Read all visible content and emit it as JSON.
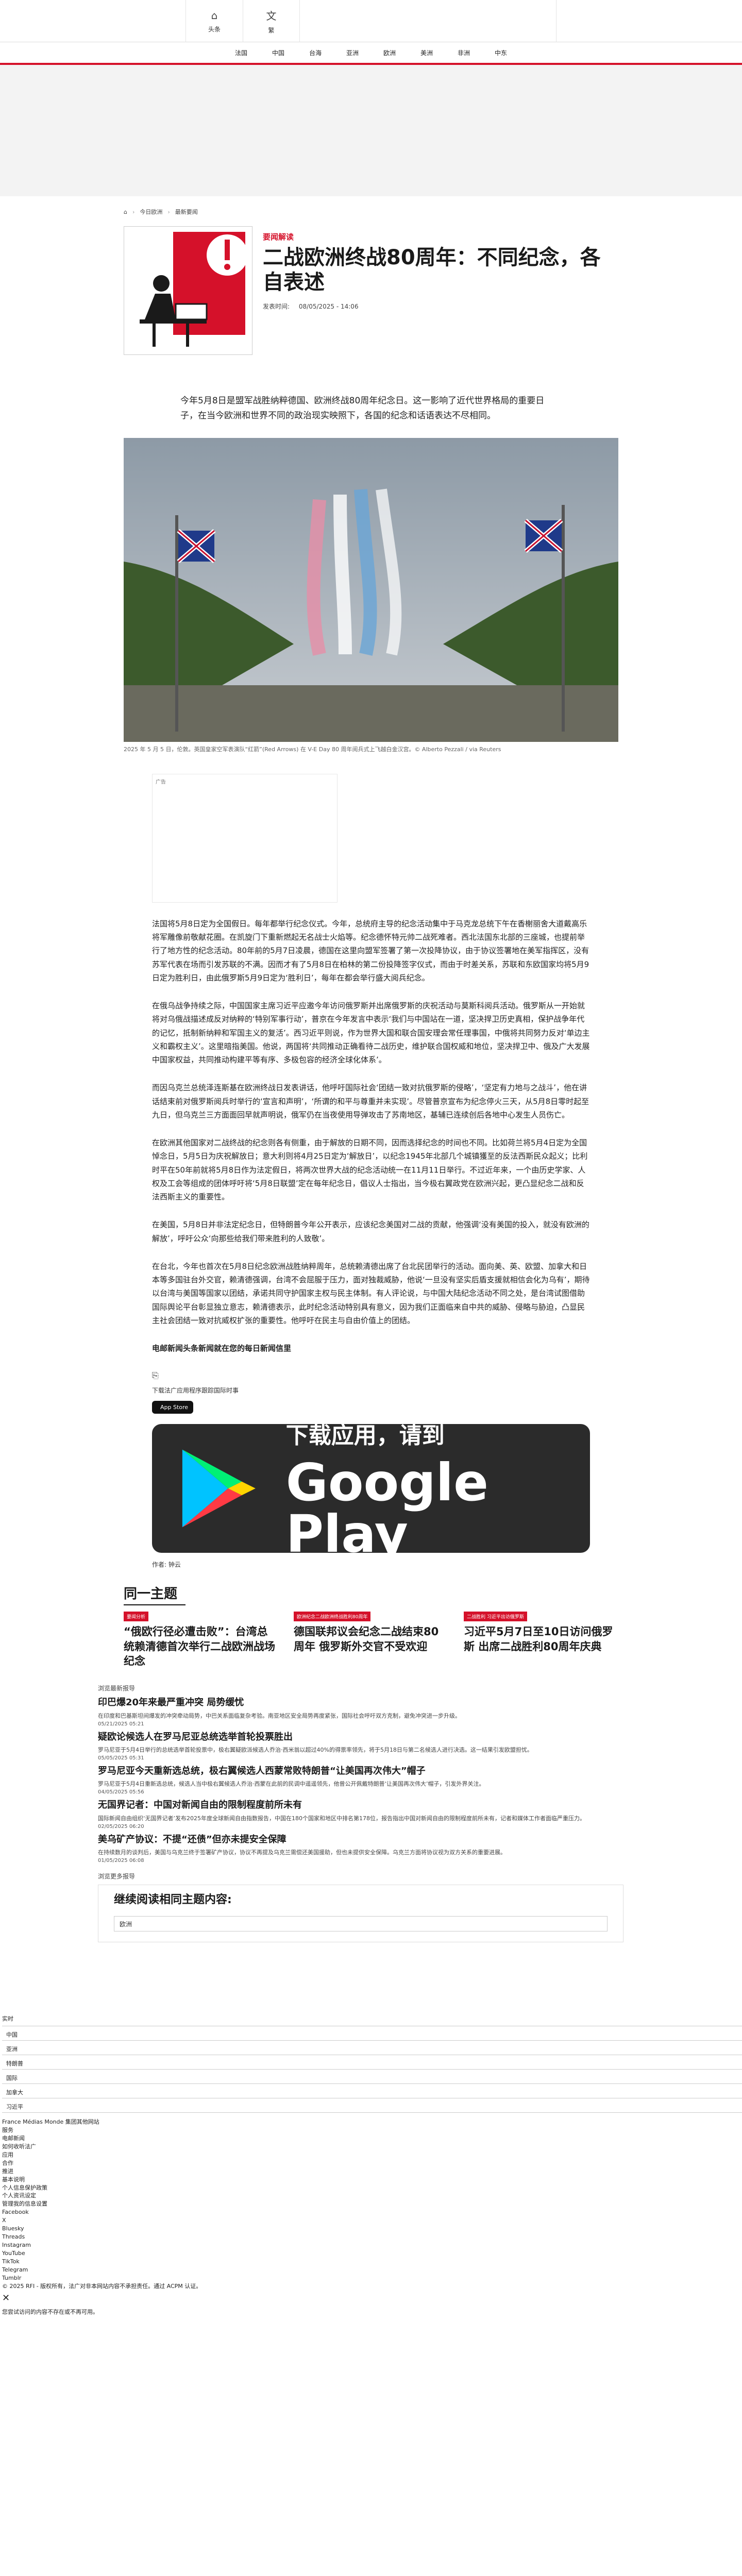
{
  "header": {
    "home_label": "头条",
    "translate_label": "繁"
  },
  "nav": [
    "法国",
    "中国",
    "台海",
    "亚洲",
    "欧洲",
    "美洲",
    "非洲",
    "中东"
  ],
  "breadcrumb": [
    "今日欧洲",
    "最新要闻"
  ],
  "article": {
    "kicker": "要闻解读",
    "title": "二战欧洲终战80周年：不同纪念，各自表述",
    "pub_label": "发表时间:",
    "pub_date": "08/05/2025 - 14:06",
    "lead": "今年5月8日是盟军战胜纳粹德国、欧洲终战80周年纪念日。这一影响了近代世界格局的重要日子，在当今欧洲和世界不同的政治现实映照下，各国的纪念和话语表达不尽相同。",
    "photo_caption": "2025 年 5 月 5 日，伦敦。英国皇家空军表演队“红箭”(Red Arrows) 在 V-E Day 80 周年阅兵式上飞越白金汉宫。© Alberto Pezzali / via Reuters",
    "ad_label": "广告",
    "paragraphs": [
      "法国将5月8日定为全国假日。每年都举行纪念仪式。今年，总统府主导的纪念活动集中于马克龙总统下午在香榭丽舍大道戴高乐将军雕像前敬献花圈。在凯旋门下重新燃起无名战士火焰等。纪念德怀特元帅二战死难者。西北法国东北部的三座城，也提前举行了地方性的纪念活动。80年前的5月7日凌晨，德国在这里向盟军签署了第一次投降协议，由于协议签署地在美军指挥区，没有苏军代表在场而引发苏联的不满。因而才有了5月8日在柏林的第二份投降签字仪式，而由于时差关系，苏联和东欧国家均将5月9日定为胜利日，由此俄罗斯5月9日定为‘胜利日’，每年在都会举行盛大阅兵纪念。",
      "在俄乌战争持续之际，中国国家主席习近平应邀今年访问俄罗斯并出席俄罗斯的庆祝活动与莫斯科阅兵活动。俄罗斯从一开始就将对乌俄战描述成反对纳粹的‘特别军事行动’，普京在今年发言中表示‘我们与中国站在一道，坚决捍卫历史真相，保护战争年代的记忆，抵制新纳粹和军国主义的复活’。西习近平则说，作为世界大国和联合国安理会常任理事国，中俄将共同努力反对‘单边主义和霸权主义’。这里暗指美国。他说，两国将‘共同推动正确看待二战历史，维护联合国权威和地位，坚决捍卫中、俄及广大发展中国家权益，共同推动构建平等有序、多极包容的经济全球化体系’。",
      "而因乌克兰总统泽连斯基在欧洲终战日发表讲话，他呼吁国际社会‘团结一致对抗俄罗斯的侵略’，‘坚定有力地与之战斗’，他在讲话结束前对俄罗斯阅兵时举行的‘宣言和声明’，‘所谓的和平与尊重并未实现’。尽管普京宣布为纪念停火三天，从5月8日零时起至九日，但乌克兰三方面面回早就声明说，俄军仍在当夜使用导弹攻击了苏南地区，基辅已连续创后各地中心发生人员伤亡。",
      "在欧洲其他国家对二战终战的纪念则各有侧重，由于解放的日期不同，因而选择纪念的时间也不同。比如荷兰将5月4日定为全国悼念日，5月5日为庆祝解放日；意大利则将4月25日定为‘解放日’，以纪念1945年北部几个城镇獲至的反法西斯民众起义；比利时平在50年前就将5月8日作为法定假日，将两次世界大战的纪念活动统一在11月11日举行。不过近年来，一个由历史学家、人权及工会等组成的团体呼吁将‘5月8日联盟’定在每年纪念日，倡议人士指出，当今极右翼政党在欧洲兴起，更凸显纪念二战和反法西斯主义的重要性。",
      "在美国，5月8日并非法定纪念日，但特朗普今年公开表示，应该纪念美国对二战的贡献，他强调‘没有美国的投入，就没有欧洲的解放’，呼吁公众‘向那些给我们带来胜利的人致敬’。",
      "在台北，今年也首次在5月8日纪念欧洲战胜纳粹周年，总统赖清德出席了台北民团举行的活动。面向美、英、欧盟、加拿大和日本等多国驻台外交官，赖清德强调，台湾不会屈服于压力，面对独裁威胁，他说‘一旦没有坚实后盾支援就相信会化为乌有’，期待以台湾与美国等国家以团结，承诺共同守护国家主权与民主体制。有人评论说，与中国大陆纪念活动不同之处，是台湾试图借助国际舆论平台彰显独立意志，赖清德表示，此时纪念活动特别具有意义，因为我们正面临来自中共的威胁、侵略与胁迫，凸显民主社会团结一致对抗威权扩张的重要性。他呼吁在民主与自由价值上的团结。",
      "电邮新闻头条新闻就在您的每日新闻信里"
    ],
    "download_label": "下载法广应用程序跟踪国际时事",
    "appstore_label": "App Store",
    "gp_top": "下载应用，请到",
    "gp_main": "Google Play",
    "author": "作者:  钟云"
  },
  "same_topic": {
    "title": "同一主题",
    "cards": [
      {
        "tag": "要闻分析",
        "title": "“俄欧行径必遭击败”：台湾总统赖清德首次举行二战欧洲战场纪念"
      },
      {
        "tag": "欧洲纪念二战欧洲终战胜利80周年",
        "title": "德国联邦议会纪念二战结束80周年 俄罗斯外交官不受欢迎"
      },
      {
        "tag": "二战胜利 习近平出访俄罗斯",
        "title": "习近平5月7日至10日访问俄罗斯 出席二战胜利80周年庆典"
      }
    ]
  },
  "feed": {
    "header": "浏览最新报导",
    "items": [
      {
        "date": "05/21/2025\n05:21",
        "title": "印巴爆20年来最严重冲突 局势缓忧",
        "text": "在印度和巴基斯坦间爆发的冲突牵动局势，中巴关系面临复杂考验。南亚地区安全局势再度紧张，国际社会呼吁双方克制，避免冲突进一步升级。",
        "d": "05/21/2025\n05:21"
      },
      {
        "title": "疑欧论候选人在罗马尼亚总统选举首轮投票胜出",
        "text": "罗马尼亚于5月4日举行的总统选举首轮投票中，极右翼疑欧派候选人乔治·西米翁以超过40%的得票率领先，将于5月18日与第二名候选人进行决选。这一结果引发欧盟担忧。",
        "d": "05/05/2025\n05:31"
      },
      {
        "title": "罗马尼亚今天重新选总统，极右翼候选人西蒙常败特朗普“让美国再次伟大”帽子",
        "text": "罗马尼亚于5月4日重新选总统，候选人当中极右翼候选人乔治·西蒙在此前的民调中遥遥领先，他曾公开佩戴特朗普‘让美国再次伟大’帽子，引发外界关注。",
        "d": "04/05/2025\n05:56"
      },
      {
        "title": "无国界记者：中国对新闻自由的限制程度前所未有",
        "text": "国际新闻自由组织‘无国界记者’发布2025年度全球新闻自由指数报告，中国在180个国家和地区中排名第178位，报告指出中国对新闻自由的限制程度前所未有，记者和媒体工作者面临严重压力。",
        "d": "02/05/2025\n06:20"
      },
      {
        "title": "美乌矿产协议：不提“还债”但亦未提安全保障",
        "text": "在持续数月的谈判后，美国与乌克兰终于签署矿产协议，协议不再提及乌克兰需偿还美国援助，但也未提供安全保障。乌克兰方面将协议视为双方关系的重要进展。",
        "d": "01/05/2025\n06:08"
      }
    ],
    "more": "浏览更多报导"
  },
  "continue": {
    "title": "继续阅读相同主题内容:",
    "input_value": "欧洲"
  },
  "bottom": {
    "label_top": "实时",
    "check_items": [
      "中国",
      "亚洲",
      "特朗普",
      "国际",
      "加拿大",
      "习近平"
    ],
    "links": [
      "France Médias Monde 集团其他网站",
      "服务",
      "电邮新闻",
      "如何收听法广",
      "应用",
      "合作",
      "推进",
      "基本说明",
      "个人信息保护政策",
      "个人资讯设定",
      "管理我的信息设置",
      "Facebook",
      "X",
      "Bluesky",
      "Threads",
      "Instagram",
      "YouTube",
      "TikTok",
      "Telegram",
      "Tumblr",
      "© 2025 RFI - 版权所有，法广对非本网站内容不承担责任。通过 ACPM 认证。"
    ],
    "footnote": "您尝试访问的内容不存在或不再可用。"
  }
}
